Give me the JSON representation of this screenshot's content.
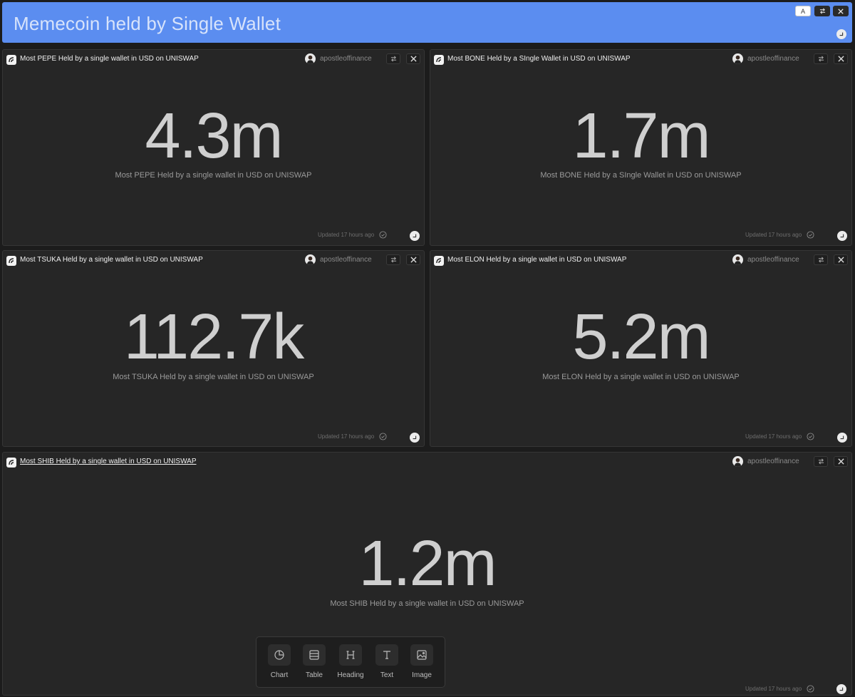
{
  "dashboard": {
    "title": "Memecoin held by Single Wallet",
    "controls": {
      "text_button": "A"
    }
  },
  "cards": [
    {
      "title": "Most PEPE Held by a single wallet in USD on UNISWAP",
      "author": "apostleoffinance",
      "value": "4.3m",
      "label": "Most PEPE Held by a single wallet in USD on UNISWAP",
      "updated": "Updated 17 hours ago"
    },
    {
      "title": "Most BONE Held by a SIngle Wallet in USD on UNISWAP",
      "author": "apostleoffinance",
      "value": "1.7m",
      "label": "Most BONE Held by a SIngle Wallet in USD on UNISWAP",
      "updated": "Updated 17 hours ago"
    },
    {
      "title": "Most TSUKA Held by a single wallet in USD on UNISWAP",
      "author": "apostleoffinance",
      "value": "112.7k",
      "label": "Most TSUKA Held by a single wallet in USD on UNISWAP",
      "updated": "Updated 17 hours ago"
    },
    {
      "title": "Most ELON Held by a single wallet in USD on UNISWAP",
      "author": "apostleoffinance",
      "value": "5.2m",
      "label": "Most ELON Held by a single wallet in USD on UNISWAP",
      "updated": "Updated 17 hours ago"
    },
    {
      "title": "Most SHIB Held by a single wallet in USD on UNISWAP",
      "author": "apostleoffinance",
      "value": "1.2m",
      "label": "Most SHIB Held by a single wallet in USD on UNISWAP",
      "updated": "Updated 17 hours ago"
    }
  ],
  "toolbar": {
    "items": [
      {
        "label": "Chart",
        "icon": "pie-chart-icon"
      },
      {
        "label": "Table",
        "icon": "table-icon"
      },
      {
        "label": "Heading",
        "icon": "heading-icon"
      },
      {
        "label": "Text",
        "icon": "text-icon"
      },
      {
        "label": "Image",
        "icon": "image-icon"
      }
    ]
  }
}
